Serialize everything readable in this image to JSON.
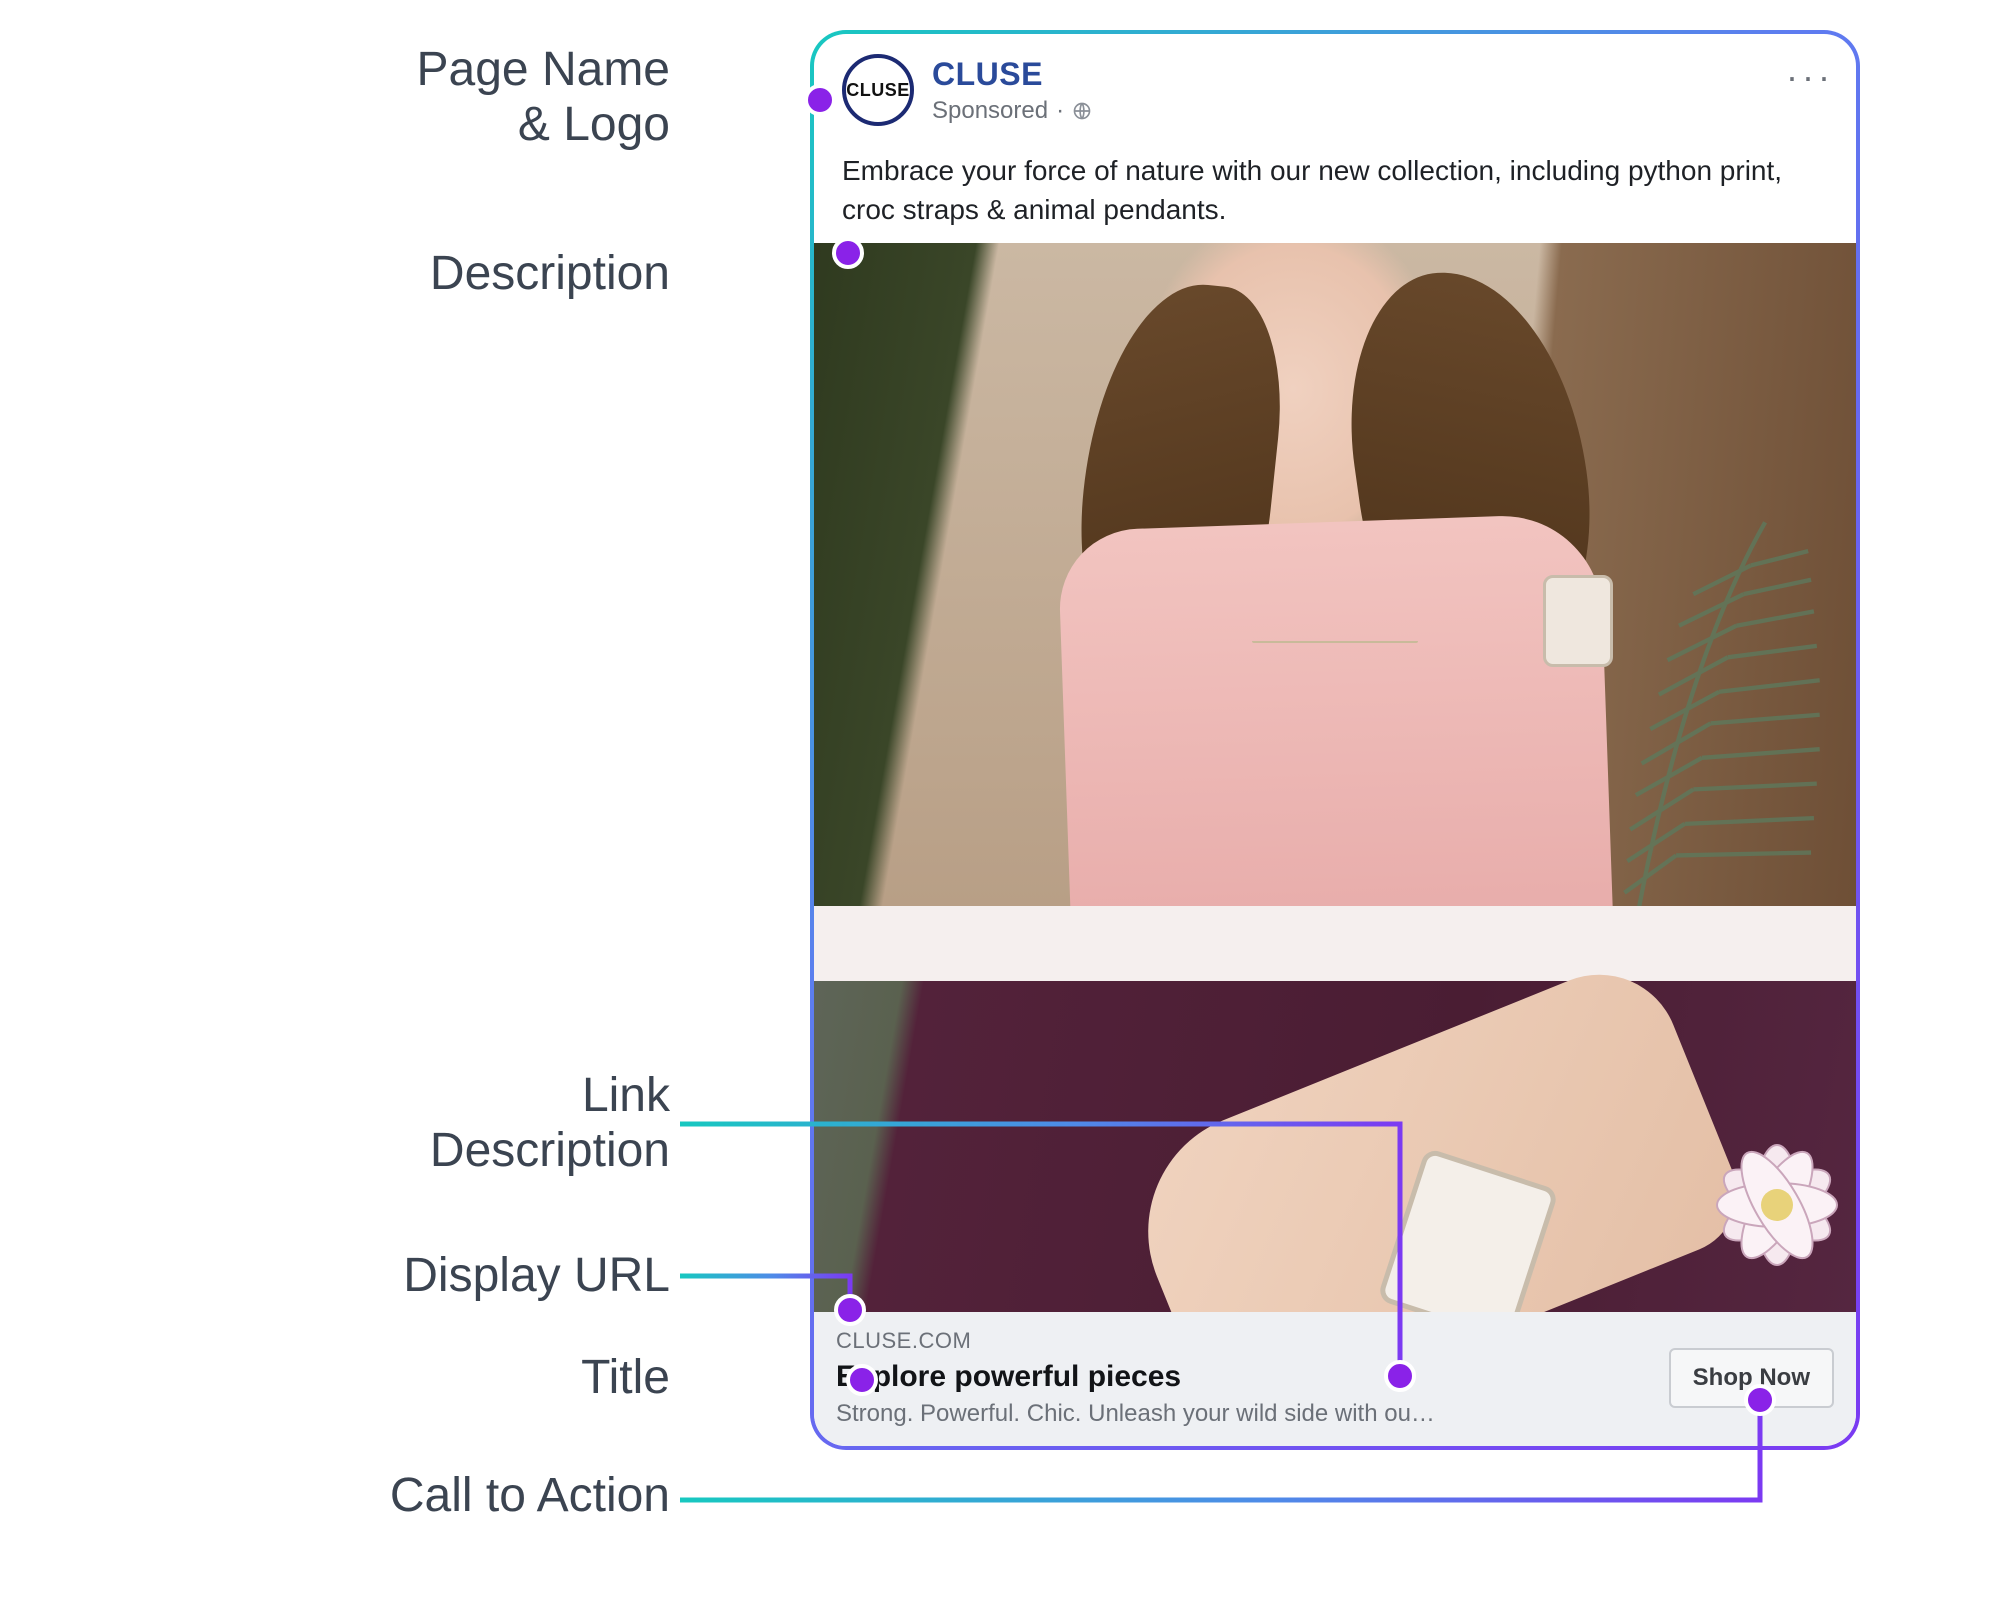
{
  "annotations": {
    "page_name_logo": "Page Name\n& Logo",
    "description": "Description",
    "link_description": "Link\nDescription",
    "display_url": "Display URL",
    "title": "Title",
    "call_to_action": "Call to Action"
  },
  "ad": {
    "logo_text": "CLUSE",
    "page_name": "CLUSE",
    "sponsored_label": "Sponsored",
    "dot_separator": "·",
    "menu_glyph": "···",
    "body_text": "Embrace your force of nature with our new collection, including python print, croc straps & animal pendants.",
    "display_url": "CLUSE.COM",
    "title": "Explore powerful pieces",
    "link_description": "Strong. Powerful. Chic. Unleash your wild side with ou…",
    "cta_label": "Shop Now"
  },
  "colors": {
    "gradient_start": "#17c8c0",
    "gradient_mid": "#5e7cf0",
    "gradient_end": "#7b3af2",
    "callout_dot": "#8a22e8",
    "label_text": "#3b4451"
  }
}
